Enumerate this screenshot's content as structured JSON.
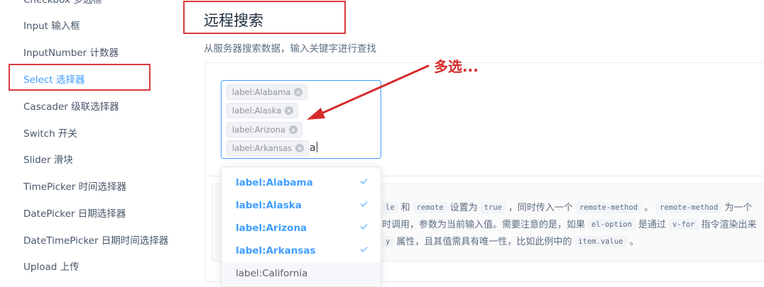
{
  "sidebar": {
    "items": [
      {
        "label": "Checkbox 多选框"
      },
      {
        "label": "Input 输入框"
      },
      {
        "label": "InputNumber 计数器"
      },
      {
        "label": "Select 选择器"
      },
      {
        "label": "Cascader 级联选择器"
      },
      {
        "label": "Switch 开关"
      },
      {
        "label": "Slider 滑块"
      },
      {
        "label": "TimePicker 时间选择器"
      },
      {
        "label": "DatePicker 日期选择器"
      },
      {
        "label": "DateTimePicker 日期时间选择器"
      },
      {
        "label": "Upload 上传"
      }
    ],
    "active_index": 3
  },
  "main": {
    "title": "远程搜索",
    "subtitle": "从服务器搜索数据，输入关键字进行查找"
  },
  "select": {
    "tags": [
      "label:Alabama",
      "label:Alaska",
      "label:Arizona",
      "label:Arkansas"
    ],
    "query": "a"
  },
  "dropdown": {
    "options": [
      {
        "label": "label:Alabama",
        "selected": true
      },
      {
        "label": "label:Alaska",
        "selected": true
      },
      {
        "label": "label:Arizona",
        "selected": true
      },
      {
        "label": "label:Arkansas",
        "selected": true
      },
      {
        "label": "label:California",
        "selected": false
      }
    ]
  },
  "description": {
    "line1": {
      "t1": "和",
      "c1": "remote",
      "t2": "设置为",
      "c2": "true",
      "t3": "，同时传入一个",
      "c3": "remote-method",
      "t4": "。",
      "c4": "remote-method",
      "t5": "为一个"
    },
    "line2": {
      "t1": "时调用，参数为当前输入值。需要注意的是，如果",
      "c1": "el-option",
      "t2": "是通过",
      "c2": "v-for",
      "t3": "指令渲染出来"
    },
    "line3": {
      "t1": "属性，且其值需具有唯一性，比如此例中的",
      "c1": "item.value",
      "t2": "。"
    },
    "partial": {
      "le": "le",
      "y": "y"
    }
  },
  "annotation": {
    "text": "多选..."
  },
  "colors": {
    "accent": "#409eff",
    "annotation": "#d72b2b"
  }
}
